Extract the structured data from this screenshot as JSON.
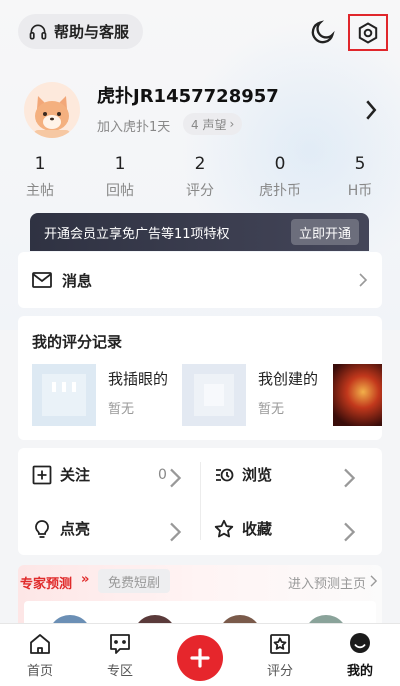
{
  "header": {
    "help_label": "帮助与客服",
    "help_icon": "headset-icon",
    "night_icon": "moon-icon",
    "settings_icon": "gear-icon",
    "settings_highlight_color": "#e0262b"
  },
  "profile": {
    "username": "虎扑JR1457728957",
    "join_days": "加入虎扑1天",
    "reputation": "4 声望",
    "avatar_icon": "cat-avatar"
  },
  "stats": [
    {
      "value": "1",
      "label": "主帖"
    },
    {
      "value": "1",
      "label": "回帖"
    },
    {
      "value": "2",
      "label": "评分"
    },
    {
      "value": "0",
      "label": "虎扑币"
    },
    {
      "value": "5",
      "label": "H币"
    }
  ],
  "vip_banner": {
    "text": "开通会员立享免广告等11项特权",
    "button": "立即开通"
  },
  "messages": {
    "label": "消息"
  },
  "rating_records": {
    "title": "我的评分记录",
    "items": [
      {
        "name": "我插眼的",
        "sub": "暂无"
      },
      {
        "name": "我创建的",
        "sub": "暂无"
      }
    ]
  },
  "grid": {
    "follow": {
      "label": "关注",
      "count": "0"
    },
    "history": {
      "label": "浏览"
    },
    "like": {
      "label": "点亮"
    },
    "favorite": {
      "label": "收藏"
    }
  },
  "expert": {
    "tab_active": "专家预测",
    "arrows": "»",
    "tab_inactive": "免费短剧",
    "link": "进入预测主页"
  },
  "bottom_nav": {
    "items": [
      {
        "label": "首页",
        "icon": "home-icon"
      },
      {
        "label": "专区",
        "icon": "zone-icon"
      },
      {
        "label": "评分",
        "icon": "rating-star-icon"
      },
      {
        "label": "我的",
        "icon": "profile-icon"
      }
    ],
    "fab_icon": "plus-icon",
    "accent": "#e6262c"
  }
}
